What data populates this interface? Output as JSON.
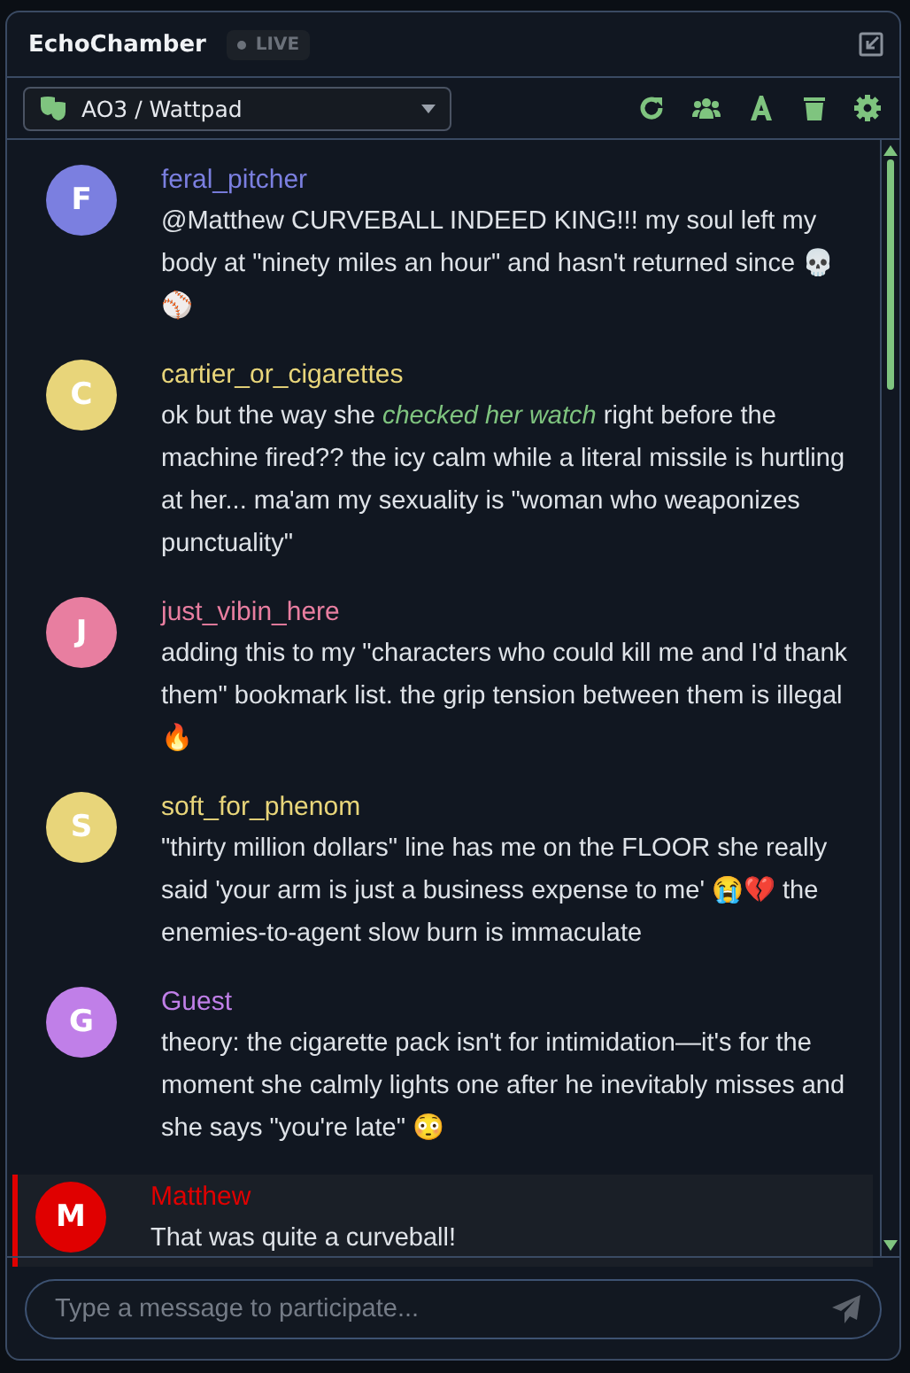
{
  "header": {
    "title": "EchoChamber",
    "badge": "LIVE"
  },
  "toolbar": {
    "source": "AO3 / Wattpad"
  },
  "messages": [
    {
      "initial": "F",
      "name": "feral_pitcher",
      "color": "#7b7fe0",
      "text": "@Matthew CURVEBALL INDEED KING!!! my soul left my body at \"ninety miles an hour\" and hasn't returned since 💀⚾",
      "own": false
    },
    {
      "initial": "C",
      "name": "cartier_or_cigarettes",
      "color": "#e8d57a",
      "text": "ok but the way she *checked her watch* right before the machine fired?? the icy calm while a literal missile is hurtling at her... ma'am my sexuality is \"woman who weaponizes punctuality\"",
      "own": false
    },
    {
      "initial": "J",
      "name": "just_vibin_here",
      "color": "#e87ea0",
      "text": "adding this to my \"characters who could kill me and I'd thank them\" bookmark list. the grip tension between them is illegal 🔥",
      "own": false
    },
    {
      "initial": "S",
      "name": "soft_for_phenom",
      "color": "#e8d57a",
      "text": "\"thirty million dollars\" line has me on the FLOOR she really said 'your arm is just a business expense to me' 😭💔 the enemies-to-agent slow burn is immaculate",
      "own": false
    },
    {
      "initial": "G",
      "name": "Guest",
      "color": "#c07fe8",
      "text": "theory: the cigarette pack isn't for intimidation—it's for the moment she calmly lights one after he inevitably misses and she says \"you're late\" 😳",
      "own": false
    },
    {
      "initial": "M",
      "name": "Matthew",
      "color": "#e00000",
      "text": "That was quite a curveball!",
      "own": true
    }
  ],
  "composer": {
    "placeholder": "Type a message to participate..."
  }
}
